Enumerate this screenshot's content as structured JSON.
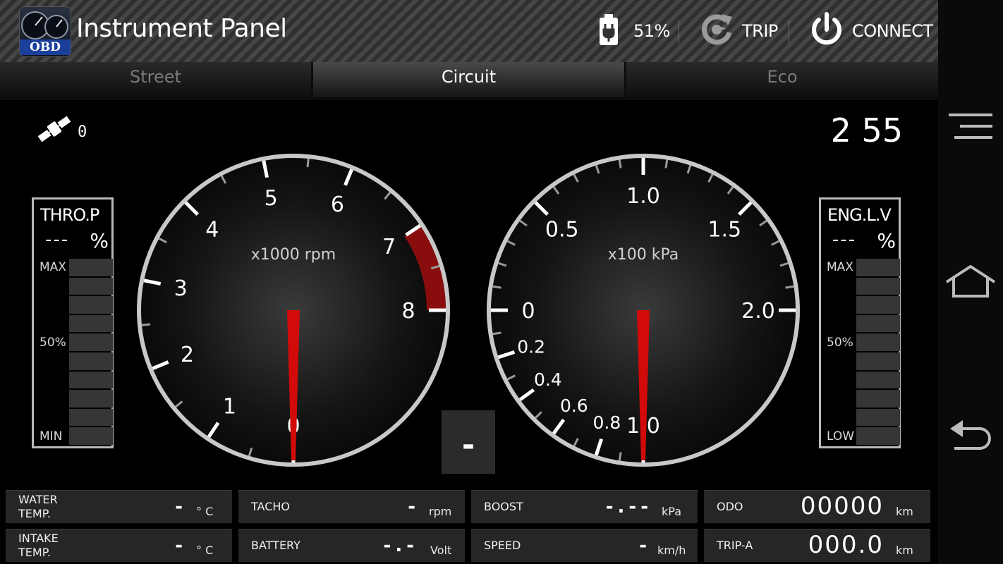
{
  "header": {
    "title": "Instrument Panel",
    "logo_text": "OBD",
    "battery_percent": "51%",
    "trip_label": "TRIP",
    "connect_label": "CONNECT"
  },
  "tabs": [
    {
      "label": "Street",
      "active": false
    },
    {
      "label": "Circuit",
      "active": true
    },
    {
      "label": "Eco",
      "active": false
    }
  ],
  "status": {
    "satellites": "0",
    "clock": "2 55"
  },
  "throttle": {
    "title": "THRO.P",
    "value": "---",
    "unit": "%",
    "max": "MAX",
    "mid": "50%",
    "min": "MIN"
  },
  "engine_load": {
    "title": "ENG.L.V",
    "value": "---",
    "unit": "%",
    "max": "MAX",
    "mid": "50%",
    "min": "LOW"
  },
  "tacho_dial": {
    "unit_label": "x1000 rpm",
    "numbers": [
      "0",
      "1",
      "2",
      "3",
      "4",
      "5",
      "6",
      "7",
      "8"
    ],
    "redline_start": 7,
    "needle_value": 0
  },
  "boost_dial": {
    "unit_label": "x100 kPa",
    "numbers": [
      "1.0",
      "0.8",
      "0.6",
      "0.4",
      "0.2",
      "0",
      "0.5",
      "1.0",
      "1.5",
      "2.0"
    ],
    "needle_value": -1.0
  },
  "center_indicator": "-",
  "readouts": [
    {
      "label": "WATER\nTEMP.",
      "value": "-",
      "unit": "° C"
    },
    {
      "label": "TACHO",
      "value": "-",
      "unit": "rpm"
    },
    {
      "label": "BOOST",
      "value": "-.--",
      "unit": "kPa"
    },
    {
      "label": "ODO",
      "value": "00000",
      "unit": "km"
    },
    {
      "label": "INTAKE\nTEMP.",
      "value": "-",
      "unit": "° C"
    },
    {
      "label": "BATTERY",
      "value": "-.-",
      "unit": "Volt"
    },
    {
      "label": "SPEED",
      "value": "-",
      "unit": "km/h"
    },
    {
      "label": "TRIP-A",
      "value": "000.0",
      "unit": "km"
    }
  ],
  "icons": {
    "battery": "battery-charging-icon",
    "trip": "trip-reset-icon",
    "connect": "power-icon",
    "satellite": "satellite-icon",
    "menu": "menu-icon",
    "home": "home-icon",
    "back": "back-icon"
  },
  "colors": {
    "redline": "#8a0d0d",
    "needle": "#d20a0a",
    "bezel": "#c8c8c8"
  }
}
